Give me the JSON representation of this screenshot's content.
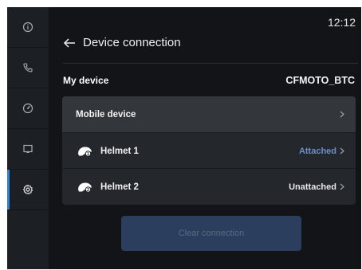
{
  "status_bar": {
    "time": "12:12"
  },
  "sidebar": {
    "items": [
      {
        "icon": "info-icon",
        "active": false
      },
      {
        "icon": "phone-icon",
        "active": false
      },
      {
        "icon": "gauge-icon",
        "active": false
      },
      {
        "icon": "screen-cast-icon",
        "active": false
      },
      {
        "icon": "gear-icon",
        "active": true
      }
    ]
  },
  "header": {
    "title": "Device connection"
  },
  "my_device": {
    "label": "My device",
    "value": "CFMOTO_BTC"
  },
  "mobile_section": {
    "label": "Mobile device"
  },
  "helmets": [
    {
      "label": "Helmet 1",
      "status": "Attached",
      "status_color": "#6e8fc7"
    },
    {
      "label": "Helmet 2",
      "status": "Unattached",
      "status_color": "#e8e8e8"
    }
  ],
  "actions": {
    "clear_label": "Clear connection"
  },
  "colors": {
    "background": "#121417",
    "sidebar": "#1c1f24",
    "card": "#24272c",
    "accent": "#2f7fe0",
    "button": "#2b3e5e"
  }
}
